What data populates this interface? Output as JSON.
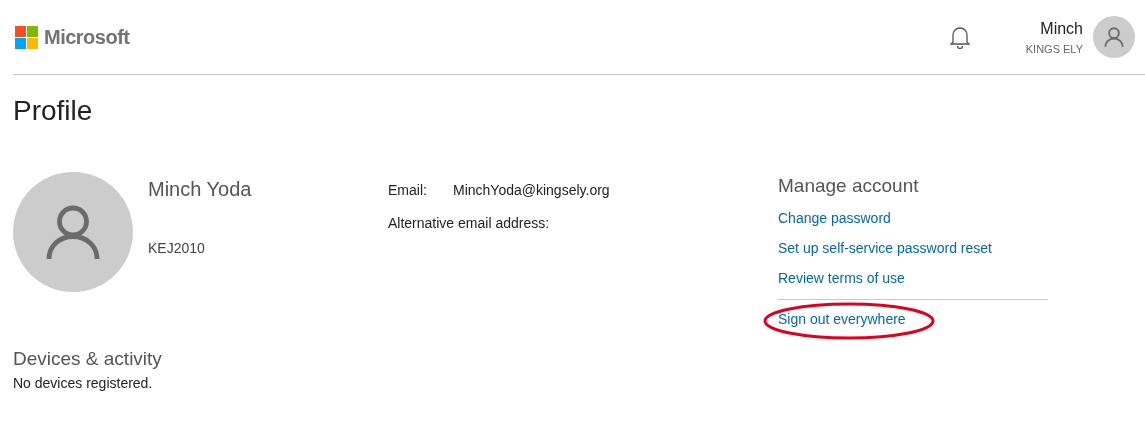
{
  "header": {
    "brand": "Microsoft",
    "user": {
      "name": "Minch",
      "org": "KINGS ELY"
    }
  },
  "page_title": "Profile",
  "profile": {
    "name": "Minch Yoda",
    "id": "KEJ2010"
  },
  "contact": [
    {
      "label": "Email:",
      "value": "MinchYoda@kingsely.org"
    },
    {
      "label": "Alternative email address:"
    }
  ],
  "manage": {
    "title": "Manage account",
    "links": [
      {
        "label": "Change password",
        "highlighted": false
      },
      {
        "label": "Set up self-service password reset",
        "highlighted": false
      },
      {
        "label": "Review terms of use",
        "highlighted": false
      }
    ],
    "after_divider": [
      {
        "label": "Sign out everywhere",
        "highlighted": true
      }
    ]
  },
  "devices": {
    "title": "Devices & activity",
    "message": "No devices registered."
  }
}
